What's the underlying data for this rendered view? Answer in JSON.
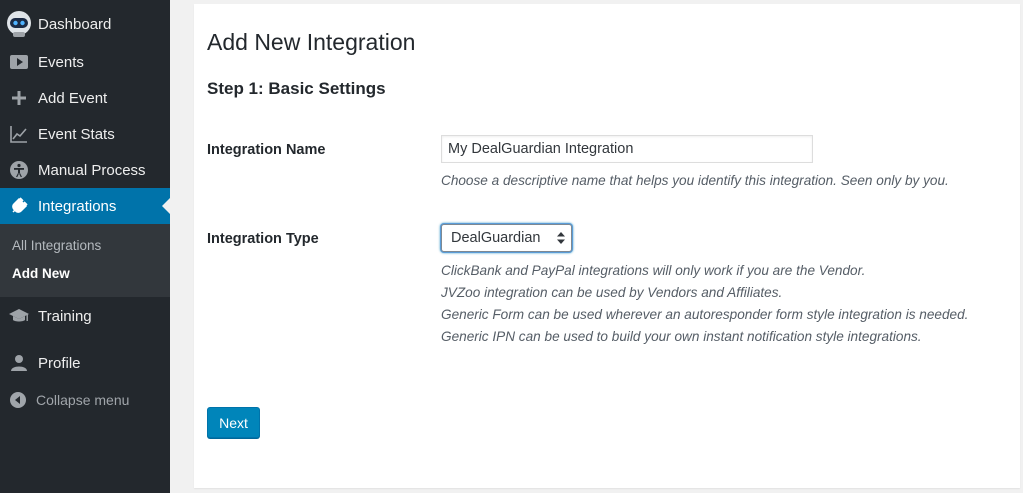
{
  "sidebar": {
    "items": [
      {
        "label": "Dashboard",
        "icon": "robot-avatar-icon"
      },
      {
        "label": "Events",
        "icon": "play-icon"
      },
      {
        "label": "Add Event",
        "icon": "plus-icon"
      },
      {
        "label": "Event Stats",
        "icon": "chart-line-icon"
      },
      {
        "label": "Manual Process",
        "icon": "accessibility-icon"
      },
      {
        "label": "Integrations",
        "icon": "plugin-icon",
        "active": true
      }
    ],
    "submenu": [
      {
        "label": "All Integrations"
      },
      {
        "label": "Add New",
        "current": true
      }
    ],
    "items_after": [
      {
        "label": "Training",
        "icon": "graduation-cap-icon"
      },
      {
        "label": "Profile",
        "icon": "user-icon"
      }
    ],
    "collapse_label": "Collapse menu"
  },
  "main": {
    "title": "Add New Integration",
    "step_title": "Step 1: Basic Settings",
    "fields": {
      "name": {
        "label": "Integration Name",
        "value": "My DealGuardian Integration",
        "description": "Choose a descriptive name that helps you identify this integration. Seen only by you."
      },
      "type": {
        "label": "Integration Type",
        "selected": "DealGuardian",
        "description_lines": [
          "ClickBank and PayPal integrations will only work if you are the Vendor.",
          "JVZoo integration can be used by Vendors and Affiliates.",
          "Generic Form can be used wherever an autoresponder form style integration is needed.",
          "Generic IPN can be used to build your own instant notification style integrations."
        ]
      }
    },
    "next_label": "Next"
  },
  "colors": {
    "sidebar_bg": "#23282d",
    "submenu_bg": "#32373c",
    "accent": "#0073aa",
    "button": "#0085ba"
  }
}
